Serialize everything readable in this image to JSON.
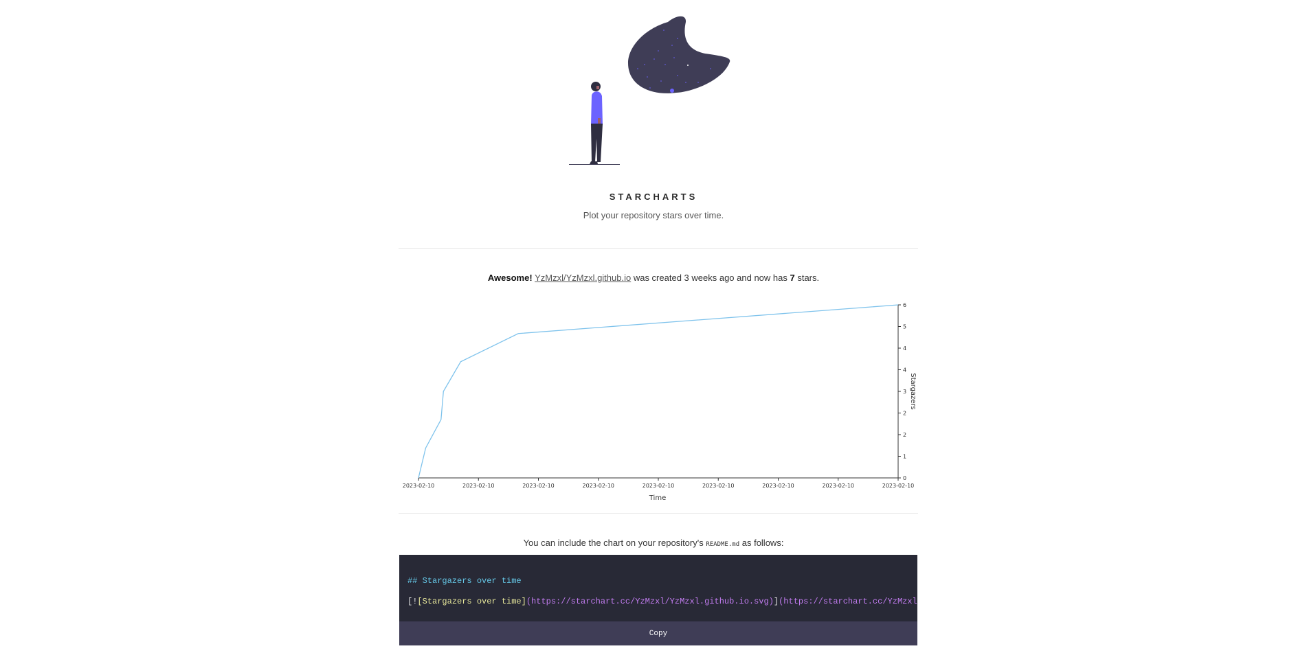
{
  "header": {
    "brand": "STARCHARTS",
    "tagline": "Plot your repository stars over time."
  },
  "summary": {
    "prefix": "Awesome!",
    "repo": "YzMzxl/YzMzxl.github.io",
    "middle": " was created 3 weeks ago and now has ",
    "stars": "7",
    "suffix": " stars."
  },
  "chart_data": {
    "type": "line",
    "xlabel": "Time",
    "ylabel": "Stargazers",
    "x_tick_labels": [
      "2023-02-10",
      "2023-02-10",
      "2023-02-10",
      "2023-02-10",
      "2023-02-10",
      "2023-02-10",
      "2023-02-10",
      "2023-02-10",
      "2023-02-10"
    ],
    "y_tick_labels": [
      "0",
      "1",
      "2",
      "2",
      "3",
      "4",
      "4",
      "5",
      "6"
    ],
    "ylim": [
      0,
      7
    ],
    "series": [
      {
        "color": "#7fc3ec",
        "x": [
          0,
          0.015,
          0.047,
          0.052,
          0.088,
          0.208,
          1.0
        ],
        "y": [
          0,
          1.21,
          2.36,
          3.5,
          4.7,
          5.84,
          7
        ]
      }
    ]
  },
  "embed": {
    "prefix": "You can include the chart on your repository's ",
    "filename": "README.md",
    "suffix": " as follows:",
    "code_line1": "## Stargazers over time",
    "code_line2_open": "[!",
    "code_line2_alt": "[Stargazers over time]",
    "code_line2_url1": "(https://starchart.cc/YzMzxl/YzMzxl.github.io.svg)",
    "code_line2_mid": "]",
    "code_line2_url2": "(https://starchart.cc/YzMzxl/YzMzxl.github.io)",
    "copy_label": "Copy"
  }
}
